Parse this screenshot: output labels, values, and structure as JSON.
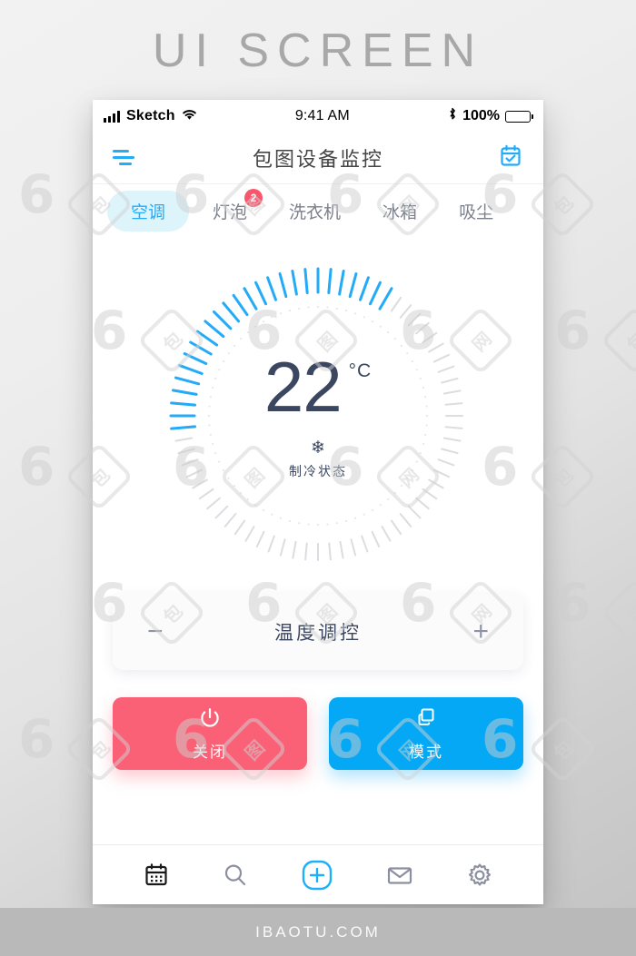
{
  "page": {
    "heading": "UI SCREEN",
    "footer": "IBAOTU.COM"
  },
  "colors": {
    "accent_blue": "#23ABF8",
    "action_blue": "#04A8F4",
    "danger_red": "#FA6176",
    "badge_red": "#F9566C",
    "navy_text": "#3B4760",
    "tab_pill_bg": "#DDF4FB",
    "dial_inactive": "#DCDDE0"
  },
  "statusbar": {
    "signal_icon": "signal-bars-icon",
    "carrier": "Sketch",
    "wifi_icon": "wifi-icon",
    "time": "9:41 AM",
    "bluetooth_icon": "bluetooth-icon",
    "battery_percent": "100%",
    "battery_icon": "battery-full-icon"
  },
  "navbar": {
    "menu_icon": "menu-lines-icon",
    "title": "包图设备监控",
    "calendar_icon": "calendar-check-icon"
  },
  "tabs": [
    {
      "label": "空调",
      "active": true,
      "badge": null
    },
    {
      "label": "灯泡",
      "active": false,
      "badge": "2"
    },
    {
      "label": "洗衣机",
      "active": false,
      "badge": null
    },
    {
      "label": "冰箱",
      "active": false,
      "badge": null
    },
    {
      "label": "吸尘",
      "active": false,
      "badge": null
    }
  ],
  "dial": {
    "temperature": "22",
    "unit": "°C",
    "mode_icon": "snowflake-icon",
    "mode_glyph": "❄",
    "mode_label": "制冷状态",
    "total_ticks": 72,
    "active_ticks": 26,
    "active_start_index": 53
  },
  "control_card": {
    "minus_label": "−",
    "title": "温度调控",
    "plus_label": "+"
  },
  "actions": [
    {
      "icon": "power-icon",
      "label": "关闭",
      "style": "off"
    },
    {
      "icon": "layers-copy-icon",
      "label": "模式",
      "style": "mode"
    }
  ],
  "bottomnav": [
    {
      "icon": "calendar-icon",
      "active": true
    },
    {
      "icon": "search-icon",
      "active": false
    },
    {
      "icon": "plus-circle-icon",
      "active": false
    },
    {
      "icon": "mail-icon",
      "active": false
    },
    {
      "icon": "settings-gear-icon",
      "active": false
    }
  ],
  "watermark": {
    "logo": "6",
    "text": "包图网"
  }
}
